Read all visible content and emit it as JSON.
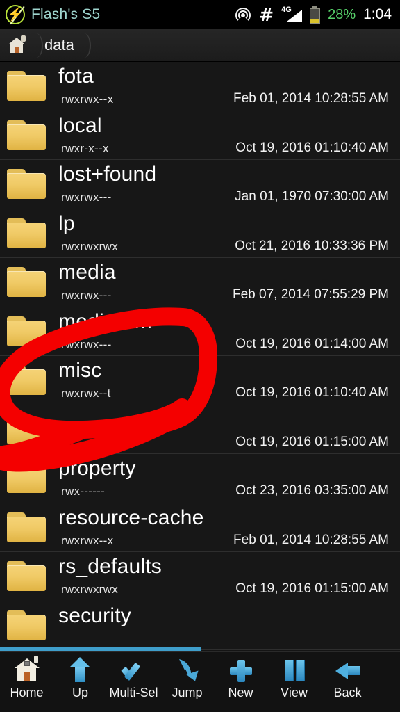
{
  "statusbar": {
    "app_title": "Flash's S5",
    "logo_icon": "flash-bolt-logo",
    "icons": [
      "hotspot-icon",
      "hash-icon",
      "signal-4g-icon",
      "battery-icon"
    ],
    "network_label": "4G",
    "battery_percent": "28%",
    "time": "1:04"
  },
  "breadcrumb": {
    "home_icon": "home-lock-icon",
    "items": [
      {
        "label": "data"
      }
    ]
  },
  "filelist": {
    "rows": [
      {
        "name": "fota",
        "perm": "rwxrwx--x",
        "date": "Feb 01, 2014 10:28:55 AM",
        "obscured": false
      },
      {
        "name": "local",
        "perm": "rwxr-x--x",
        "date": "Oct 19, 2016 01:10:40 AM",
        "obscured": false
      },
      {
        "name": "lost+found",
        "perm": "rwxrwx---",
        "date": "Jan 01, 1970 07:30:00 AM",
        "obscured": false
      },
      {
        "name": "lp",
        "perm": "rwxrwxrwx",
        "date": "Oct 21, 2016 10:33:36 PM",
        "obscured": false
      },
      {
        "name": "media",
        "perm": "rwxrwx---",
        "date": "Feb 07, 2014 07:55:29 PM",
        "obscured": false
      },
      {
        "name": "mediadrm",
        "perm": "rwxrwx---",
        "date": "Oct 19, 2016 01:14:00 AM",
        "obscured": false
      },
      {
        "name": "misc",
        "perm": "rwxrwx--t",
        "date": "Oct 19, 2016 01:10:40 AM",
        "obscured": false
      },
      {
        "name": "",
        "perm": "",
        "date": "Oct 19, 2016 01:15:00 AM",
        "obscured": true
      },
      {
        "name": "property",
        "perm": "rwx------",
        "date": "Oct 23, 2016 03:35:00 AM",
        "obscured": false
      },
      {
        "name": "resource-cache",
        "perm": "rwxrwx--x",
        "date": "Feb 01, 2014 10:28:55 AM",
        "obscured": false
      },
      {
        "name": "rs_defaults",
        "perm": "rwxrwxrwx",
        "date": "Oct 19, 2016 01:15:00 AM",
        "obscured": false
      },
      {
        "name": "security",
        "perm": "",
        "date": "",
        "obscured": false
      }
    ]
  },
  "toolbar": {
    "items": [
      {
        "label": "Home",
        "icon": "home-icon"
      },
      {
        "label": "Up",
        "icon": "up-arrow-icon"
      },
      {
        "label": "Multi-Sel",
        "icon": "checkmark-icon"
      },
      {
        "label": "Jump",
        "icon": "jump-arrow-icon"
      },
      {
        "label": "New",
        "icon": "plus-icon"
      },
      {
        "label": "View",
        "icon": "grid-view-icon"
      },
      {
        "label": "Back",
        "icon": "back-arrow-icon"
      }
    ]
  },
  "annotation": {
    "type": "hand-drawn-circle",
    "color": "#f40000"
  },
  "colors": {
    "background": "#141414",
    "row_background": "#171717",
    "folder": "#f0ca66",
    "accent_blue": "#3f9ecb",
    "annotation_red": "#f40000",
    "battery_green": "#57d06a"
  }
}
